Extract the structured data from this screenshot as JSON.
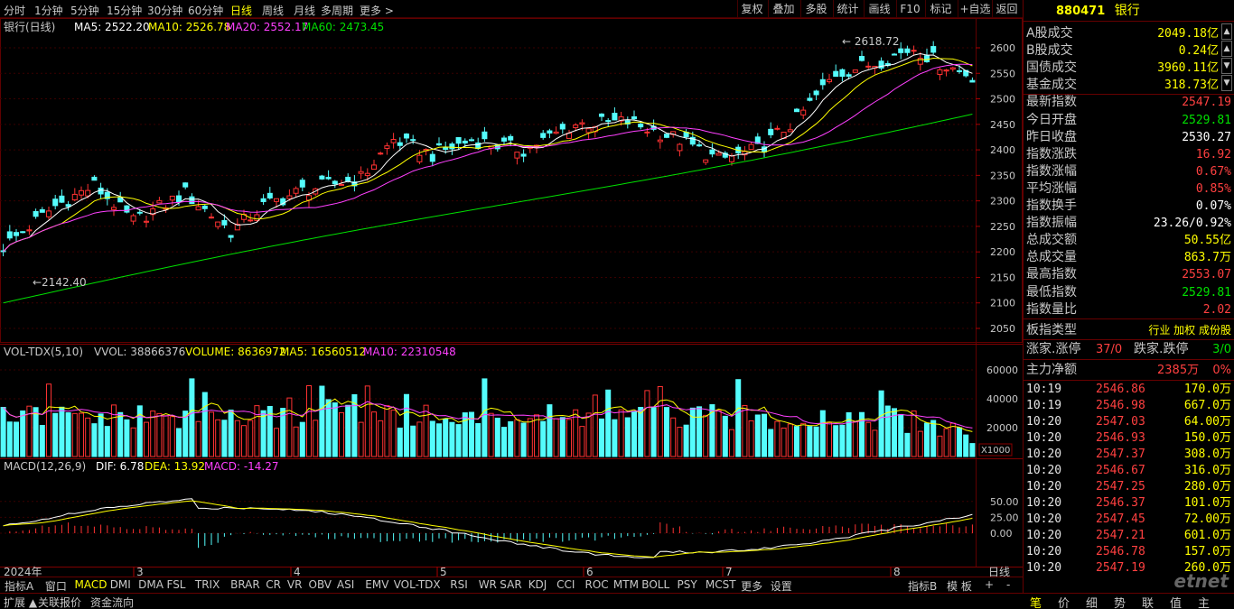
{
  "toolbar": {
    "timeframes": [
      "分时",
      "1分钟",
      "5分钟",
      "15分钟",
      "30分钟",
      "60分钟",
      "日线",
      "周线",
      "月线",
      "多周期",
      "更多 >"
    ],
    "active_timeframe": "日线",
    "right_buttons": [
      "复权",
      "叠加",
      "多股",
      "统计",
      "画线",
      "F10",
      "标记",
      "+自选",
      "返回"
    ]
  },
  "main_chart": {
    "title": "银行(日线)",
    "ma5": "MA5: 2522.20",
    "ma10": "MA10: 2526.78",
    "ma20": "MA20: 2552.17",
    "ma60": "MA60: 2473.45",
    "high_label": "2618.72",
    "low_label": "2142.40",
    "y_ticks": [
      "2600",
      "2550",
      "2500",
      "2450",
      "2400",
      "2350",
      "2300",
      "2250",
      "2200",
      "2150",
      "2100",
      "2050"
    ]
  },
  "volume_chart": {
    "title": "VOL-TDX(5,10)",
    "vvol": "VVOL: 38866376",
    "volume": "VOLUME: 8636972",
    "ma5": "MA5: 16560512",
    "ma10": "MA10: 22310548",
    "y_ticks": [
      "60000",
      "40000",
      "20000"
    ],
    "unit": "X1000"
  },
  "macd_chart": {
    "title": "MACD(12,26,9)",
    "dif": "DIF: 6.78",
    "dea": "DEA: 13.92",
    "macd": "MACD: -14.27",
    "y_ticks": [
      "50.00",
      "25.00",
      "0.00"
    ]
  },
  "date_axis": {
    "year_label": "2024年",
    "months": [
      "3",
      "4",
      "5",
      "6",
      "7",
      "8"
    ],
    "period": "日线"
  },
  "bottom_tabs": [
    "指标A",
    "窗口",
    "MACD",
    "DMI",
    "DMA",
    "FSL",
    "TRIX",
    "BRAR",
    "CR",
    "VR",
    "OBV",
    "ASI",
    "EMV",
    "VOL-TDX",
    "RSI",
    "WR",
    "SAR",
    "KDJ",
    "CCI",
    "ROC",
    "MTM",
    "BOLL",
    "PSY",
    "MCST",
    "更多",
    "设置"
  ],
  "bottom_right_tabs": [
    "指标B",
    "模 板",
    "+",
    "-"
  ],
  "bottom_bar": [
    "扩展 ▲",
    "关联报价",
    "资金流向"
  ],
  "panel": {
    "code": "880471",
    "name": "银行",
    "stats": [
      {
        "label": "A股成交",
        "value": "2049.18亿",
        "color": "#ffff00"
      },
      {
        "label": "B股成交",
        "value": "0.24亿",
        "color": "#ffff00"
      },
      {
        "label": "国债成交",
        "value": "3960.11亿",
        "color": "#ffff00"
      },
      {
        "label": "基金成交",
        "value": "318.73亿",
        "color": "#ffff00"
      },
      {
        "label": "最新指数",
        "value": "2547.19",
        "color": "#ff4040"
      },
      {
        "label": "今日开盘",
        "value": "2529.81",
        "color": "#00e000"
      },
      {
        "label": "昨日收盘",
        "value": "2530.27",
        "color": "#ffffff"
      },
      {
        "label": "指数涨跌",
        "value": "16.92",
        "color": "#ff4040"
      },
      {
        "label": "指数涨幅",
        "value": "0.67%",
        "color": "#ff4040"
      },
      {
        "label": "平均涨幅",
        "value": "0.85%",
        "color": "#ff4040"
      },
      {
        "label": "指数换手",
        "value": "0.07%",
        "color": "#ffffff"
      },
      {
        "label": "指数振幅",
        "value": "23.26/0.92%",
        "color": "#ffffff"
      },
      {
        "label": "总成交额",
        "value": "50.55亿",
        "color": "#ffff00"
      },
      {
        "label": "总成交量",
        "value": "863.7万",
        "color": "#ffff00"
      },
      {
        "label": "最高指数",
        "value": "2553.07",
        "color": "#ff4040"
      },
      {
        "label": "最低指数",
        "value": "2529.81",
        "color": "#00e000"
      },
      {
        "label": "指数量比",
        "value": "2.02",
        "color": "#ff4040"
      }
    ],
    "type_label": "板指类型",
    "type_value": "行业 加权 成份股",
    "up_label": "涨家.涨停",
    "up_value": "37/0",
    "down_label": "跌家.跌停",
    "down_value": "3/0",
    "flow_label": "主力净额",
    "flow_value": "2385万",
    "flow_pct": "0%",
    "ticks": [
      {
        "time": "10:19",
        "price": "2546.86",
        "vol": "170.0万"
      },
      {
        "time": "10:19",
        "price": "2546.98",
        "vol": "667.0万"
      },
      {
        "time": "10:20",
        "price": "2547.03",
        "vol": "64.00万"
      },
      {
        "time": "10:20",
        "price": "2546.93",
        "vol": "150.0万"
      },
      {
        "time": "10:20",
        "price": "2547.37",
        "vol": "308.0万"
      },
      {
        "time": "10:20",
        "price": "2546.67",
        "vol": "316.0万"
      },
      {
        "time": "10:20",
        "price": "2547.25",
        "vol": "280.0万"
      },
      {
        "time": "10:20",
        "price": "2546.37",
        "vol": "101.0万"
      },
      {
        "time": "10:20",
        "price": "2547.45",
        "vol": "72.00万"
      },
      {
        "time": "10:20",
        "price": "2547.21",
        "vol": "601.0万"
      },
      {
        "time": "10:20",
        "price": "2546.78",
        "vol": "157.0万"
      },
      {
        "time": "10:20",
        "price": "2547.19",
        "vol": "260.0万"
      }
    ],
    "tabs": [
      "笔",
      "价",
      "细",
      "势",
      "联",
      "值",
      "主"
    ],
    "watermark": "etnet"
  },
  "colors": {
    "up": "#ff3232",
    "down": "#54fcfc",
    "ma5": "#ffffff",
    "ma10": "#ffff00",
    "ma20": "#ff40ff",
    "ma60": "#00e000",
    "grid": "#600000"
  }
}
